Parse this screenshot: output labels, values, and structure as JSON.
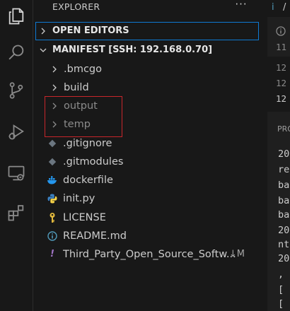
{
  "activity_bar": {
    "items": [
      {
        "icon": "explorer-icon",
        "active": true
      },
      {
        "icon": "search-icon"
      },
      {
        "icon": "source-control-icon"
      },
      {
        "icon": "run-debug-icon"
      },
      {
        "icon": "remote-explorer-icon"
      },
      {
        "icon": "extensions-icon"
      }
    ]
  },
  "explorer": {
    "title": "EXPLORER",
    "more_label": "···",
    "open_editors_label": "OPEN EDITORS",
    "workspace_label": "MANIFEST [SSH: 192.168.0.70]",
    "items": [
      {
        "name": ".bmcgo",
        "type": "folder",
        "dim": false
      },
      {
        "name": "build",
        "type": "folder",
        "dim": false
      },
      {
        "name": "output",
        "type": "folder",
        "dim": true
      },
      {
        "name": "temp",
        "type": "folder",
        "dim": true
      },
      {
        "name": ".gitignore",
        "type": "file",
        "icon": "git-file-icon"
      },
      {
        "name": ".gitmodules",
        "type": "file",
        "icon": "git-file-icon"
      },
      {
        "name": "dockerfile",
        "type": "file",
        "icon": "docker-whale-icon"
      },
      {
        "name": "init.py",
        "type": "file",
        "icon": "python-icon"
      },
      {
        "name": "LICENSE",
        "type": "file",
        "icon": "license-key-icon"
      },
      {
        "name": "README.md",
        "type": "file",
        "icon": "info-icon"
      },
      {
        "name": "Third_Party_Open_Source_Softw...",
        "type": "file",
        "icon": "exclamation-icon",
        "badge": "↓M"
      }
    ]
  },
  "editor": {
    "tab_fragment": "i",
    "tab_fragment2": "/",
    "lines_top": [
      "11"
    ],
    "lines": [
      "12",
      "12",
      "12"
    ],
    "panel_title": "PRO",
    "output_lines": [
      "20",
      "re",
      "ba",
      "ba",
      "ba",
      "20",
      "nt",
      "20",
      ",",
      "[",
      "["
    ]
  },
  "colors": {
    "accent": "#0e7ad3",
    "highlight_box": "#c8262b",
    "python_yellow": "#f7d449",
    "python_blue": "#3b82c4",
    "docker_blue": "#2496ed",
    "license_yellow": "#e2b93d",
    "info_blue": "#519aba",
    "exclaim_purple": "#a074c4"
  }
}
